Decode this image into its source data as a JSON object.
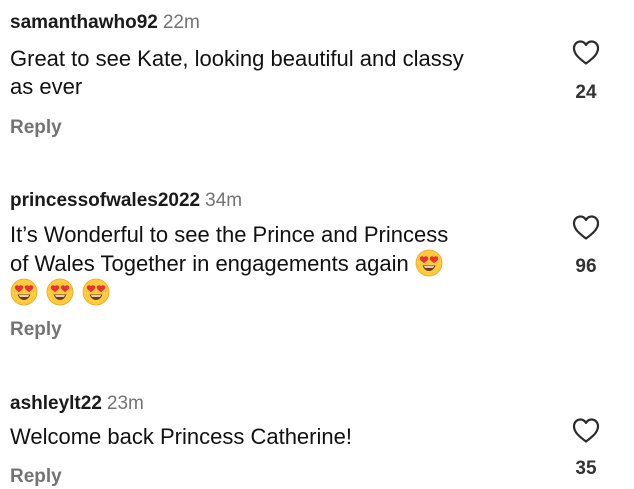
{
  "comments": [
    {
      "username": "samanthawho92",
      "time": "22m",
      "text_lines": [
        "Great to see Kate, looking beautiful and classy",
        "as ever"
      ],
      "likes": "24",
      "reply_label": "Reply"
    },
    {
      "username": "princessofwales2022",
      "time": "34m",
      "text_lines": [
        "It’s Wonderful to see the Prince and Princess",
        "of Wales Together in engagements again"
      ],
      "emoji": "smiling-face-with-heart-eyes",
      "likes": "96",
      "reply_label": "Reply"
    },
    {
      "username": "ashleylt22",
      "time": "23m",
      "text_lines": [
        "Welcome back Princess Catherine!"
      ],
      "likes": "35",
      "reply_label": "Reply"
    }
  ],
  "colors": {
    "text": "#111111",
    "muted": "#737373",
    "emoji_face": "#FFCB3D",
    "emoji_heart": "#E8303A"
  },
  "icons": {
    "like": "heart-outline-icon"
  }
}
